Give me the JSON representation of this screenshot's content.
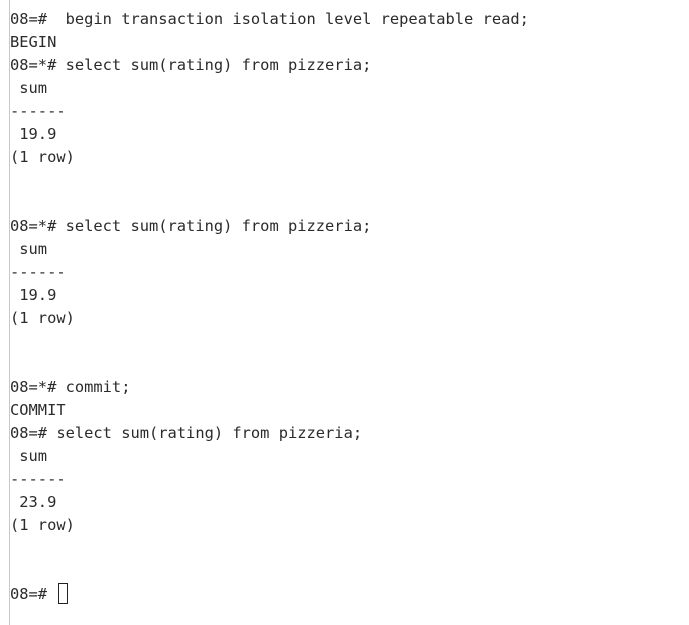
{
  "terminal": {
    "lines": [
      "08=#  begin transaction isolation level repeatable read;",
      "BEGIN",
      "08=*# select sum(rating) from pizzeria;",
      " sum",
      "------",
      " 19.9",
      "(1 row)",
      "08=*# select sum(rating) from pizzeria;",
      " sum",
      "------",
      " 19.9",
      "(1 row)",
      "08=*# commit;",
      "COMMIT",
      "08=# select sum(rating) from pizzeria;",
      " sum",
      "------",
      " 23.9",
      "(1 row)"
    ],
    "prompt": "08=#"
  }
}
